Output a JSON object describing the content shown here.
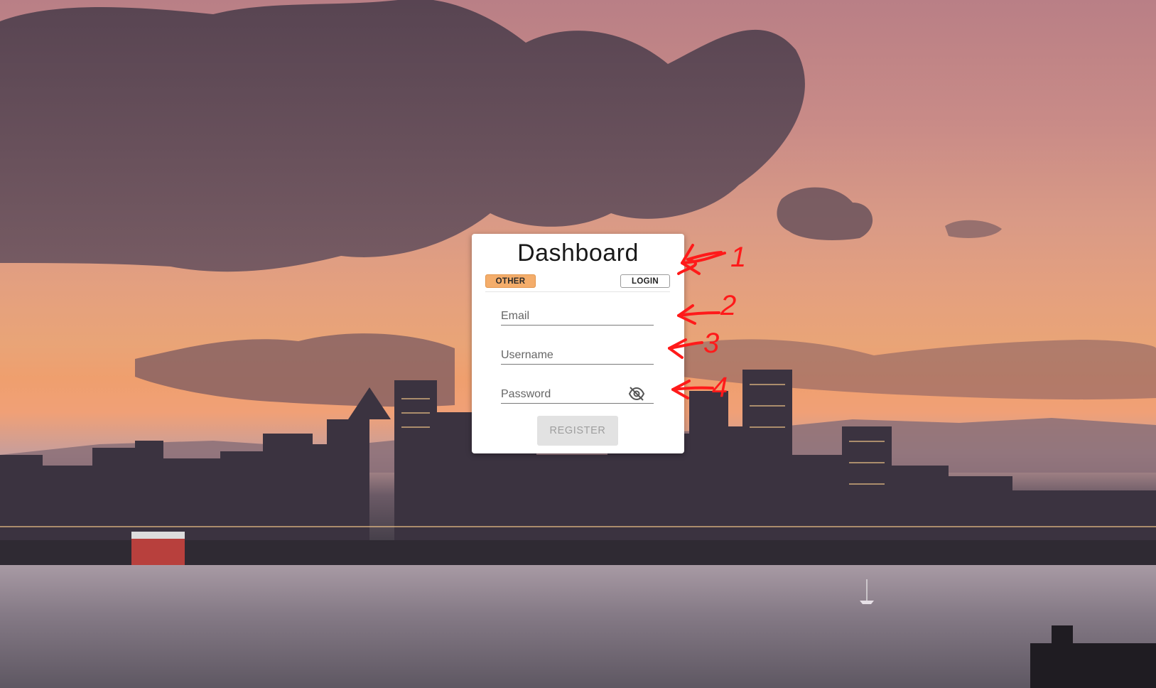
{
  "card": {
    "title": "Dashboard",
    "tabs": [
      {
        "label": "OTHER",
        "active": true
      },
      {
        "label": "LOGIN",
        "active": false
      }
    ],
    "fields": {
      "email": {
        "label": "Email",
        "value": ""
      },
      "username": {
        "label": "Username",
        "value": ""
      },
      "password": {
        "label": "Password",
        "value": ""
      }
    },
    "register_label": "REGISTER",
    "register_disabled": true
  },
  "annotations": [
    {
      "number": "1",
      "target": "card-title"
    },
    {
      "number": "2",
      "target": "email-field"
    },
    {
      "number": "3",
      "target": "username-field"
    },
    {
      "number": "4",
      "target": "password-field"
    }
  ],
  "icons": {
    "password_toggle": "eye-off-icon"
  },
  "colors": {
    "accent_chip": "#f4ad6b",
    "annotation_red": "#ff1a1a",
    "button_disabled_bg": "#e2e2e2",
    "button_disabled_text": "#9e9e9e"
  }
}
